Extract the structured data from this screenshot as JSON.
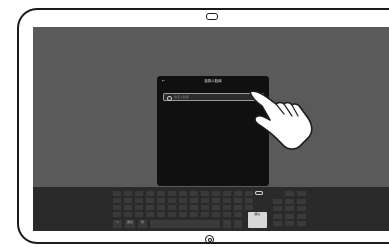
{
  "dialog": {
    "title": "选择人脸库",
    "back_icon": "back-arrow-icon",
    "search": {
      "placeholder": "搜索人脸库",
      "icon": "search-icon"
    }
  },
  "keyboard": {
    "left_keys": [
      "",
      "英文",
      "符"
    ],
    "confirm_label": "确认",
    "keyboard_icon": "keyboard-icon",
    "switch_icon": "toggle-icon"
  },
  "colors": {
    "screen_bg": "#5a5a5a",
    "dialog_bg": "#101010",
    "keyboard_bg": "#2a2a2a",
    "highlight_key": "#d8d8d8"
  }
}
